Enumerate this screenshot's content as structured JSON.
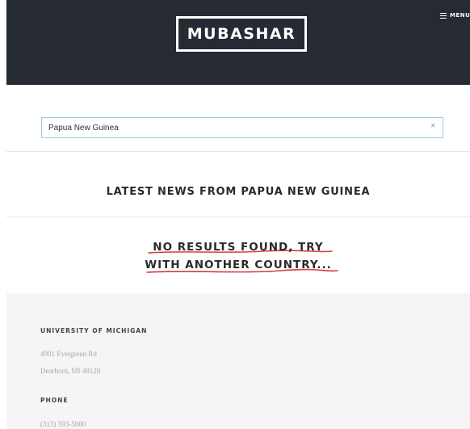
{
  "header": {
    "logo": "MUBASHAR",
    "menu_label": "MENU"
  },
  "search": {
    "value": "Papua New Guinea",
    "clear_symbol": "×"
  },
  "latest": {
    "heading": "LATEST NEWS FROM PAPUA NEW GUINEA"
  },
  "results": {
    "line1": "NO RESULTS FOUND, TRY",
    "line2": "WITH ANOTHER COUNTRY...",
    "underline_color": "#d9393e"
  },
  "footer": {
    "org_heading": "UNIVERSITY OF MICHIGAN",
    "address_line1": "4901 Evergreen Rd",
    "address_line2": "Dearborn, MI 48128",
    "phone_heading": "PHONE",
    "phone": "(313) 593-5000"
  },
  "colors": {
    "header_bg": "#262a33",
    "footer_bg": "#f5f5f5",
    "search_border": "#9ccbe3"
  }
}
